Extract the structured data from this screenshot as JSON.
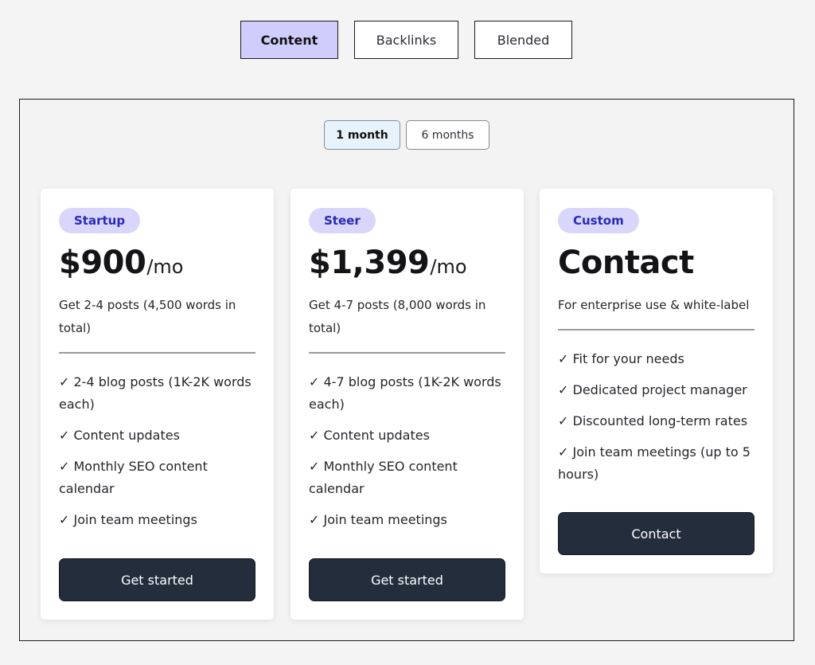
{
  "product_tabs": [
    {
      "label": "Content",
      "active": true
    },
    {
      "label": "Backlinks",
      "active": false
    },
    {
      "label": "Blended",
      "active": false
    }
  ],
  "period_toggle": [
    {
      "label": "1 month",
      "active": true
    },
    {
      "label": "6 months",
      "active": false
    }
  ],
  "plans": [
    {
      "badge": "Startup",
      "price": "$900",
      "per": "/mo",
      "description": "Get 2-4 posts (4,500 words in total)",
      "features": [
        "✓ 2-4 blog posts (1K-2K words each)",
        "✓ Content updates",
        "✓ Monthly SEO content calendar",
        "✓ Join team meetings"
      ],
      "cta": "Get started"
    },
    {
      "badge": "Steer",
      "price": "$1,399",
      "per": "/mo",
      "description": "Get 4-7 posts (8,000 words in total)",
      "features": [
        "✓ 4-7 blog posts (1K-2K words each)",
        "✓ Content updates",
        "✓ Monthly SEO content calendar",
        "✓ Join team meetings"
      ],
      "cta": "Get started"
    },
    {
      "badge": "Custom",
      "price": "Contact",
      "per": "",
      "description": "For enterprise use & white-label",
      "features": [
        "✓ Fit for your needs",
        "✓ Dedicated project manager",
        "✓ Discounted long-term rates",
        "✓ Join team meetings (up to 5 hours)"
      ],
      "cta": "Contact"
    }
  ],
  "colors": {
    "active_tab": "#cfcdfb",
    "badge_bg": "#d8d6fb",
    "badge_text": "#2a2bb5",
    "cta_bg": "#242d3c",
    "active_period": "#e7f2fb"
  }
}
